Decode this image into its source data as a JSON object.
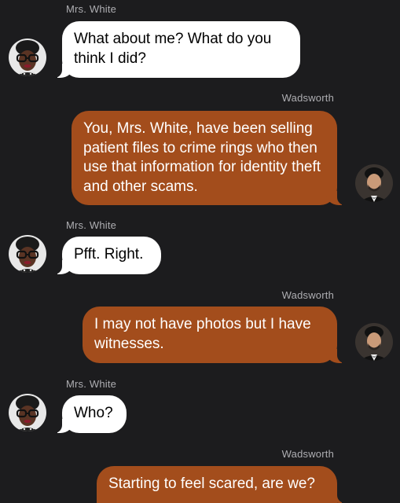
{
  "conversation": {
    "messages": [
      {
        "sender": "Mrs. White",
        "direction": "incoming",
        "text": "What about me? What do you think I did?"
      },
      {
        "sender": "Wadsworth",
        "direction": "outgoing",
        "text": "You, Mrs. White, have been selling patient files to crime rings who then use that information for identity theft and other scams."
      },
      {
        "sender": "Mrs. White",
        "direction": "incoming",
        "text": "Pfft. Right."
      },
      {
        "sender": "Wadsworth",
        "direction": "outgoing",
        "text": "I may not have photos but I have witnesses."
      },
      {
        "sender": "Mrs. White",
        "direction": "incoming",
        "text": "Who?"
      },
      {
        "sender": "Wadsworth",
        "direction": "outgoing",
        "text": "Starting to feel scared, are we?"
      }
    ]
  },
  "colors": {
    "background": "#1c1c1e",
    "incoming_bubble": "#ffffff",
    "outgoing_bubble": "#a34d1c",
    "sender_label": "#aeaeb2"
  },
  "icons": {
    "mrs_white_avatar": "woman-with-glasses-avatar",
    "wadsworth_avatar": "man-in-tuxedo-avatar"
  }
}
